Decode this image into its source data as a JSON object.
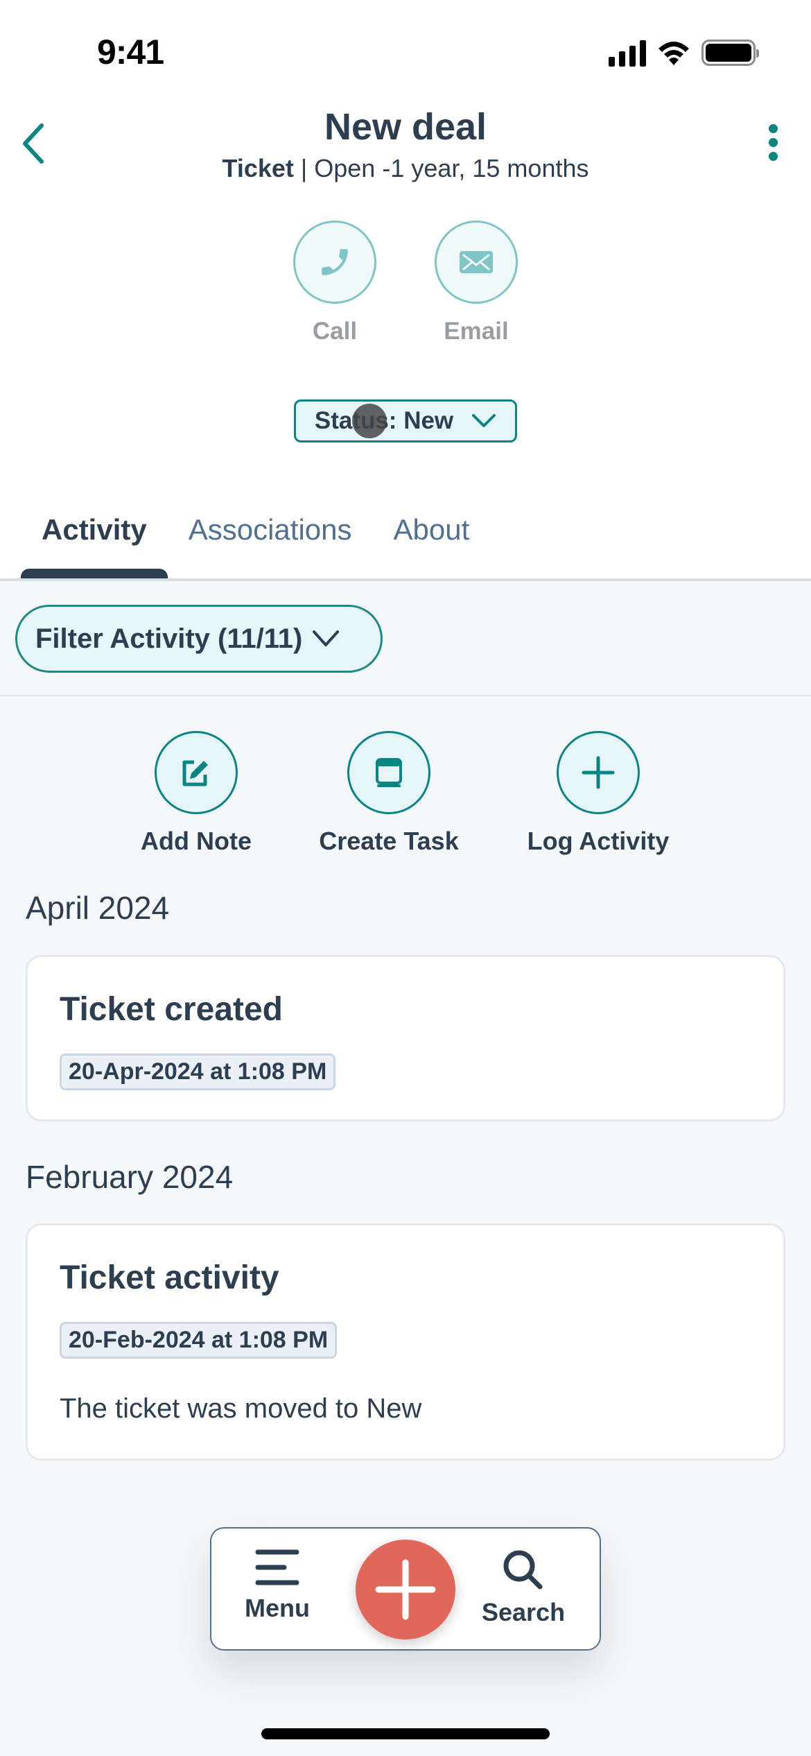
{
  "status_bar": {
    "time": "9:41"
  },
  "header": {
    "title": "New deal",
    "subtitle_type": "Ticket",
    "subtitle_rest": " | Open -1 year, 15 months"
  },
  "quick_actions": [
    {
      "label": "Call",
      "icon": "phone-icon"
    },
    {
      "label": "Email",
      "icon": "envelope-icon"
    }
  ],
  "status_dropdown": {
    "label": "Status: New"
  },
  "tabs": [
    {
      "label": "Activity",
      "active": true
    },
    {
      "label": "Associations",
      "active": false
    },
    {
      "label": "About",
      "active": false
    }
  ],
  "filter": {
    "label": "Filter Activity (11/11)"
  },
  "activity_actions": [
    {
      "label": "Add Note",
      "icon": "edit-note-icon"
    },
    {
      "label": "Create Task",
      "icon": "task-icon"
    },
    {
      "label": "Log Activity",
      "icon": "plus-icon"
    }
  ],
  "timeline": [
    {
      "month": "April 2024",
      "entries": [
        {
          "title": "Ticket created",
          "date": "20-Apr-2024 at 1:08 PM",
          "body": ""
        }
      ]
    },
    {
      "month": "February 2024",
      "entries": [
        {
          "title": "Ticket activity",
          "date": "20-Feb-2024 at 1:08 PM",
          "body": "The ticket was moved to New"
        }
      ]
    }
  ],
  "bottom_nav": {
    "menu_label": "Menu",
    "search_label": "Search"
  },
  "colors": {
    "accent": "#0b8484",
    "fab": "#e0675a",
    "text": "#2d3e50",
    "background": "#f5f8fa"
  }
}
